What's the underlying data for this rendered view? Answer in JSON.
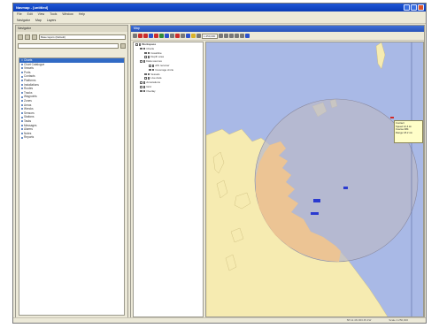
{
  "window": {
    "title": "Navmap - [untitled]"
  },
  "menu": [
    "File",
    "Edit",
    "View",
    "Tools",
    "Window",
    "Help"
  ],
  "subbar": [
    "Navigator",
    "Map",
    "Layers"
  ],
  "left_panel": {
    "header": "Navigator",
    "combo_value": "Base layers (Default)",
    "items": [
      "Charts",
      "Chart Catalogue",
      "Vessels",
      "Ports",
      "Contacts",
      "Platforms",
      "Installations",
      "Routes",
      "Tracks",
      "Waypoints",
      "Zones",
      "Areas",
      "Wrecks",
      "Sensors",
      "Stations",
      "Tasks",
      "Messages",
      "Alarms",
      "Notes",
      "Reports"
    ],
    "selected_index": 0
  },
  "document": {
    "title": "Map",
    "zoom": "1:250,000"
  },
  "layers_tree": [
    {
      "label": "Workspace",
      "level": 0
    },
    {
      "label": "Charts",
      "level": 1
    },
    {
      "label": "Coastline",
      "level": 2
    },
    {
      "label": "Depth area",
      "level": 2
    },
    {
      "label": "Data sources",
      "level": 1
    },
    {
      "label": "AIS receiver",
      "level": 3
    },
    {
      "label": "Coverage circle",
      "level": 3
    },
    {
      "label": "Vessels",
      "level": 2
    },
    {
      "label": "Live data",
      "level": 2
    },
    {
      "label": "Annotations",
      "level": 1
    },
    {
      "label": "Grid",
      "level": 1
    },
    {
      "label": "Overlay",
      "level": 1
    }
  ],
  "tooltip": {
    "lines": [
      "Contact",
      "Speed 12.4 kn",
      "Course 084",
      "Range 18.2 nm"
    ]
  },
  "status": [
    "58 12.4N 003 45.1W",
    "Scale 1:250,000"
  ],
  "colors": {
    "sea": "#a9b9e6",
    "land": "#f6ebb1",
    "coverage": "#b9b9c9",
    "coverage_land": "#f0c38f",
    "accent": "#316ac5",
    "contact": "#2a3ad0"
  }
}
